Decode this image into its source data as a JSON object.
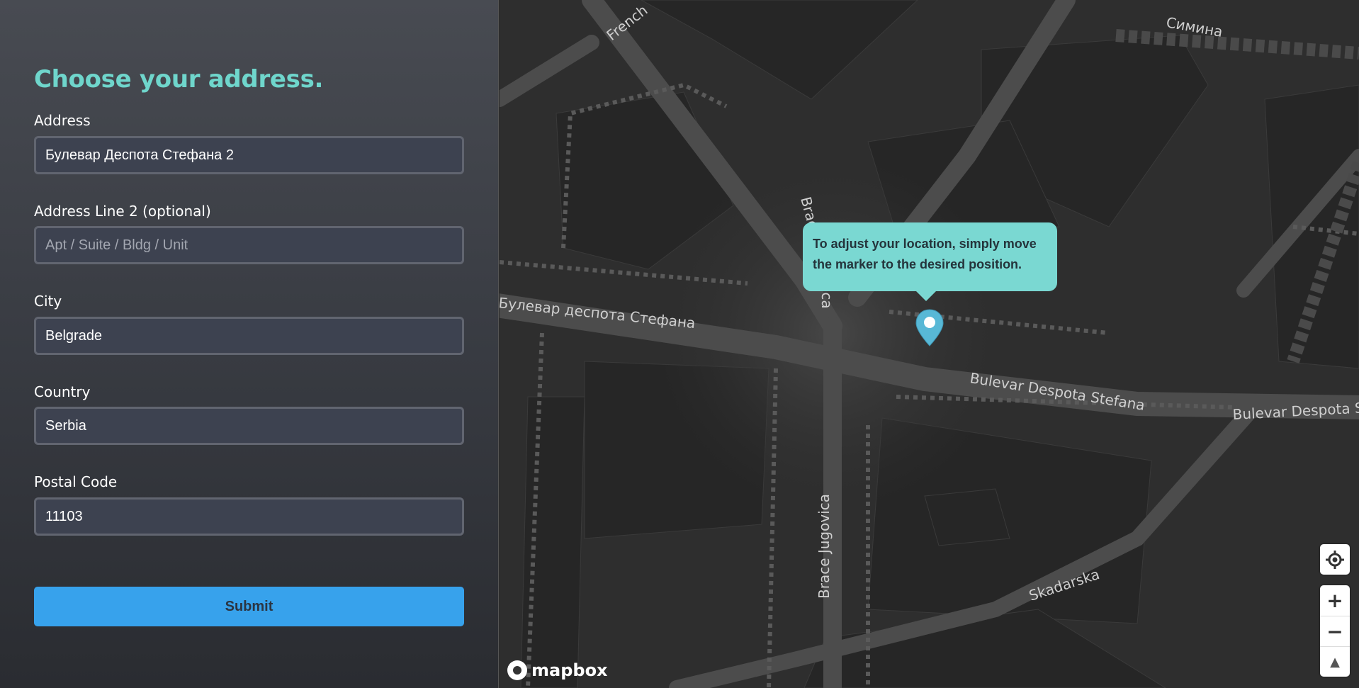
{
  "form": {
    "title": "Choose your address.",
    "address": {
      "label": "Address",
      "value": "Булевар Деспота Стефана 2"
    },
    "address2": {
      "label": "Address Line 2 (optional)",
      "placeholder": "Apt / Suite / Bldg / Unit",
      "value": ""
    },
    "city": {
      "label": "City",
      "value": "Belgrade"
    },
    "country": {
      "label": "Country",
      "value": "Serbia"
    },
    "postal": {
      "label": "Postal Code",
      "value": "11103"
    },
    "submit_label": "Submit"
  },
  "map": {
    "tooltip": "To adjust your location, simply move the marker to the desired position.",
    "streets": {
      "french": "French",
      "simina": "Симина",
      "braca": "Braće",
      "jugovica_top": "vica",
      "bulevar_cyr": "Булевар деспота Стефана",
      "bulevar_lat": "Bulevar Despota Stefana",
      "bulevar_lat_right": "Bulevar Despota S",
      "brace_jugovica": "Brace Jugovica",
      "skadarska": "Skadarska"
    },
    "controls": {
      "zoom_in": "+",
      "zoom_out": "−",
      "compass": "▲"
    },
    "attribution": "mapbox",
    "colors": {
      "marker": "#58b8d6",
      "tooltip_bg": "#7ad8d2"
    }
  }
}
